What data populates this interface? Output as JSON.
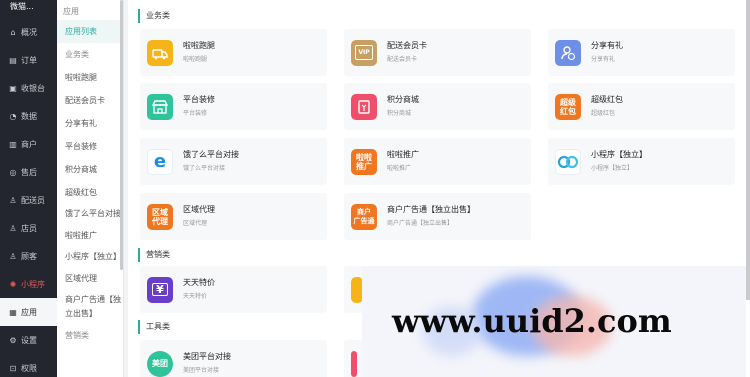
{
  "nav": {
    "brand": "微猫...",
    "items": [
      {
        "icon": "home-icon",
        "label": "概况"
      },
      {
        "icon": "order-icon",
        "label": "订单"
      },
      {
        "icon": "cashier-icon",
        "label": "收银台"
      },
      {
        "icon": "data-icon",
        "label": "数据"
      },
      {
        "icon": "store-icon",
        "label": "商户"
      },
      {
        "icon": "aftersale-icon",
        "label": "售后"
      },
      {
        "icon": "courier-icon",
        "label": "配送员"
      },
      {
        "icon": "clerk-icon",
        "label": "店员"
      },
      {
        "icon": "customer-icon",
        "label": "顾客"
      },
      {
        "icon": "miniapp-icon",
        "label": "小程序"
      },
      {
        "icon": "apps-icon",
        "label": "应用"
      },
      {
        "icon": "settings-icon",
        "label": "设置"
      },
      {
        "icon": "permission-icon",
        "label": "权限"
      }
    ]
  },
  "submenu": {
    "title": "应用",
    "items": [
      "应用列表",
      "业务类",
      "啦啦跑腿",
      "配送会员卡",
      "分享有礼",
      "平台装修",
      "积分商城",
      "超级红包",
      "饿了么平台对接",
      "啦啦推广",
      "小程序【独立】",
      "区域代理",
      "商户广告通【独立出售】",
      "营销类"
    ]
  },
  "sections": {
    "business": "业务类",
    "marketing": "营销类",
    "tools": "工具类"
  },
  "cards": [
    {
      "icon_text": "",
      "icon": "runner-icon",
      "color": "#f5b51a",
      "title": "啦啦跑腿",
      "desc": "啦啦跑腿"
    },
    {
      "icon_text": "VIP",
      "icon": "vip-card-icon",
      "color": "#c8a063",
      "title": "配送会员卡",
      "desc": "配送会员卡"
    },
    {
      "icon_text": "",
      "icon": "share-gift-icon",
      "color": "#6d8fe6",
      "title": "分享有礼",
      "desc": "分享有礼"
    },
    {
      "icon_text": "",
      "icon": "shop-decor-icon",
      "color": "#2ec39a",
      "title": "平台装修",
      "desc": "平台装修"
    },
    {
      "icon_text": "",
      "icon": "points-mall-icon",
      "color": "#ef4f6b",
      "title": "积分商城",
      "desc": "积分商城"
    },
    {
      "icon_text": "超级\n红包",
      "icon": "super-redpack-icon",
      "color": "#f07722",
      "title": "超级红包",
      "desc": "超级红包"
    },
    {
      "icon_text": "e",
      "icon": "eleme-icon",
      "color": "#ffffff",
      "title": "饿了么平台对接",
      "desc": "饿了么平台对接"
    },
    {
      "icon_text": "啦啦\n推广",
      "icon": "promote-icon",
      "color": "#f07722",
      "title": "啦啦推广",
      "desc": "啦啦推广"
    },
    {
      "icon_text": "",
      "icon": "miniapp-card-icon",
      "color": "#ffffff",
      "title": "小程序【独立】",
      "desc": "小程序【独立】"
    },
    {
      "icon_text": "区域\n代理",
      "icon": "region-agent-icon",
      "color": "#f07722",
      "title": "区域代理",
      "desc": "区域代理"
    },
    {
      "icon_text": "商户\n广告通",
      "icon": "ad-icon",
      "color": "#f07722",
      "title": "商户广告通【独立出售】",
      "desc": "商户广告通【独立出售】"
    },
    {
      "icon_text": "¥",
      "icon": "daily-deal-icon",
      "color": "#6a3fc8",
      "title": "天天特价",
      "desc": "天天特价"
    },
    {
      "icon_text": "美团",
      "icon": "meituan-icon",
      "color": "#2ec39a",
      "title": "美团平台对接",
      "desc": "美团平台对接"
    }
  ],
  "watermark": "www.uuid2.com"
}
